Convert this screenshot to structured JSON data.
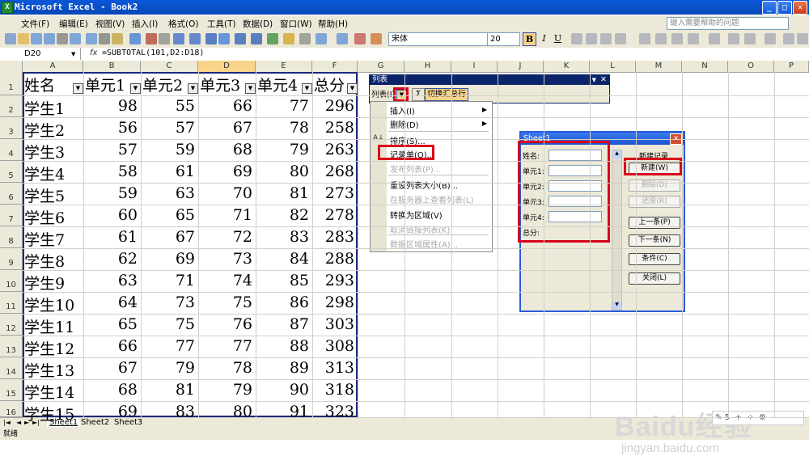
{
  "app": {
    "title": "Microsoft Excel - Book2",
    "help_placeholder": "键入需要帮助的问题"
  },
  "menu": [
    "文件(F)",
    "编辑(E)",
    "视图(V)",
    "插入(I)",
    "格式(O)",
    "工具(T)",
    "数据(D)",
    "窗口(W)",
    "帮助(H)"
  ],
  "format": {
    "font": "宋体",
    "size": "20",
    "bold": "B",
    "italic": "I",
    "underline": "U"
  },
  "namebox": "D20",
  "formula": "=SUBTOTAL(101,D2:D18)",
  "columns": [
    "A",
    "B",
    "C",
    "D",
    "E",
    "F",
    "G",
    "H",
    "I",
    "J",
    "K",
    "L",
    "M",
    "N",
    "O",
    "P"
  ],
  "rows": [
    "1",
    "2",
    "3",
    "4",
    "5",
    "6",
    "7",
    "8",
    "9",
    "10",
    "11",
    "12",
    "13",
    "14",
    "15",
    "16"
  ],
  "headers": [
    "姓名",
    "单元1",
    "单元2",
    "单元3",
    "单元4",
    "总分"
  ],
  "data": [
    [
      "学生1",
      "98",
      "55",
      "66",
      "77",
      "296"
    ],
    [
      "学生2",
      "56",
      "57",
      "67",
      "78",
      "258"
    ],
    [
      "学生3",
      "57",
      "59",
      "68",
      "79",
      "263"
    ],
    [
      "学生4",
      "58",
      "61",
      "69",
      "80",
      "268"
    ],
    [
      "学生5",
      "59",
      "63",
      "70",
      "81",
      "273"
    ],
    [
      "学生6",
      "60",
      "65",
      "71",
      "82",
      "278"
    ],
    [
      "学生7",
      "61",
      "67",
      "72",
      "83",
      "283"
    ],
    [
      "学生8",
      "62",
      "69",
      "73",
      "84",
      "288"
    ],
    [
      "学生9",
      "63",
      "71",
      "74",
      "85",
      "293"
    ],
    [
      "学生10",
      "64",
      "73",
      "75",
      "86",
      "298"
    ],
    [
      "学生11",
      "65",
      "75",
      "76",
      "87",
      "303"
    ],
    [
      "学生12",
      "66",
      "77",
      "77",
      "88",
      "308"
    ],
    [
      "学生13",
      "67",
      "79",
      "78",
      "89",
      "313"
    ],
    [
      "学生14",
      "68",
      "81",
      "79",
      "90",
      "318"
    ],
    [
      "学生15",
      "69",
      "83",
      "80",
      "91",
      "323"
    ]
  ],
  "sheets": [
    "Sheet1",
    "Sheet2",
    "Sheet3"
  ],
  "status": "就绪",
  "list_toolbar": {
    "title": "列表",
    "list_btn": "列表(I)",
    "toggle_total": "切换汇总行"
  },
  "list_menu": [
    {
      "label": "插入(I)",
      "sub": true,
      "enabled": true
    },
    {
      "label": "删除(D)",
      "sub": true,
      "enabled": true
    },
    {
      "label": "排序(S)...",
      "sub": false,
      "enabled": true
    },
    {
      "label": "记录单(O)...",
      "sub": false,
      "enabled": true
    },
    {
      "label": "发布列表(P)...",
      "sub": false,
      "enabled": false
    },
    {
      "label": "重设列表大小(B)...",
      "sub": false,
      "enabled": true
    },
    {
      "label": "在服务器上查看列表(L)",
      "sub": false,
      "enabled": false
    },
    {
      "label": "转换为区域(V)",
      "sub": false,
      "enabled": true
    },
    {
      "label": "取消链接列表(K)",
      "sub": false,
      "enabled": false
    },
    {
      "label": "数据区域属性(A)...",
      "sub": false,
      "enabled": false
    }
  ],
  "dialog": {
    "title": "Sheet1",
    "fields": [
      "姓名:",
      "单元1:",
      "单元2:",
      "单元3:",
      "单元4:"
    ],
    "total_label": "总分:",
    "new_record": "新建记录",
    "buttons": [
      {
        "label": "新建(W)",
        "enabled": true
      },
      {
        "label": "删除(D)",
        "enabled": false
      },
      {
        "label": "还原(R)",
        "enabled": false
      },
      {
        "label": "上一条(P)",
        "enabled": true
      },
      {
        "label": "下一条(N)",
        "enabled": true
      },
      {
        "label": "条件(C)",
        "enabled": true
      },
      {
        "label": "关闭(L)",
        "enabled": true
      }
    ]
  },
  "watermark": {
    "brand": "Baidu经验",
    "url": "jingyan.baidu.com"
  }
}
